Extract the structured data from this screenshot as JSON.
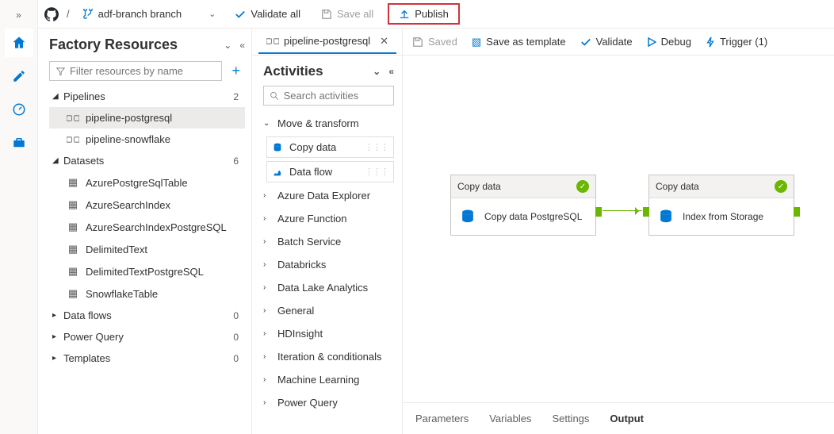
{
  "topbar": {
    "branch_label": "adf-branch branch",
    "validate_all": "Validate all",
    "save_all": "Save all",
    "publish": "Publish"
  },
  "panel1": {
    "title": "Factory Resources",
    "filter_placeholder": "Filter resources by name",
    "sections": {
      "pipelines": {
        "label": "Pipelines",
        "count": "2",
        "items": [
          "pipeline-postgresql",
          "pipeline-snowflake"
        ]
      },
      "datasets": {
        "label": "Datasets",
        "count": "6",
        "items": [
          "AzurePostgreSqlTable",
          "AzureSearchIndex",
          "AzureSearchIndexPostgreSQL",
          "DelimitedText",
          "DelimitedTextPostgreSQL",
          "SnowflakeTable"
        ]
      },
      "dataflows": {
        "label": "Data flows",
        "count": "0"
      },
      "powerquery": {
        "label": "Power Query",
        "count": "0"
      },
      "templates": {
        "label": "Templates",
        "count": "0"
      }
    }
  },
  "tab": {
    "label": "pipeline-postgresql"
  },
  "activities": {
    "title": "Activities",
    "search_placeholder": "Search activities",
    "move_transform": "Move & transform",
    "copy_data": "Copy data",
    "data_flow": "Data flow",
    "cats": [
      "Azure Data Explorer",
      "Azure Function",
      "Batch Service",
      "Databricks",
      "Data Lake Analytics",
      "General",
      "HDInsight",
      "Iteration & conditionals",
      "Machine Learning",
      "Power Query"
    ]
  },
  "canvas_toolbar": {
    "saved": "Saved",
    "save_as_template": "Save as template",
    "validate": "Validate",
    "debug": "Debug",
    "trigger": "Trigger (1)"
  },
  "nodes": {
    "n1": {
      "type": "Copy data",
      "title": "Copy data PostgreSQL"
    },
    "n2": {
      "type": "Copy data",
      "title": "Index from Storage"
    }
  },
  "bottom_tabs": [
    "Parameters",
    "Variables",
    "Settings",
    "Output"
  ],
  "bottom_active": "Output"
}
